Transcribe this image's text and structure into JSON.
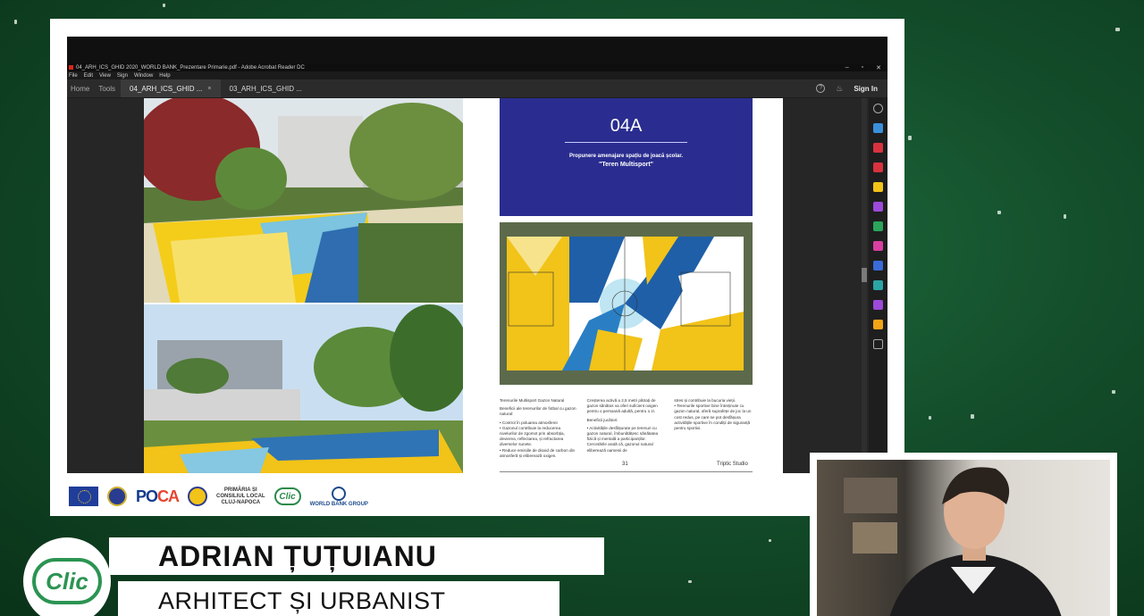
{
  "acrobat": {
    "window_title": "04_ARH_ICS_GHID 2020_WORLD BANK_Prezentare Primarie.pdf - Adobe Acrobat Reader DC",
    "window_controls": [
      "–",
      "▫",
      "✕"
    ],
    "menu": [
      "File",
      "Edit",
      "View",
      "Sign",
      "Window",
      "Help"
    ],
    "nav": [
      "Home",
      "Tools"
    ],
    "tabs": [
      {
        "label": "04_ARH_ICS_GHID ...",
        "close": "×"
      },
      {
        "label": "03_ARH_ICS_GHID ..."
      }
    ],
    "help_icon": "?",
    "sign_in": "Sign In"
  },
  "document": {
    "panel_code": "04A",
    "panel_subtitle": "Propunere amenajare spațiu de joacă școlar.",
    "panel_title": "\"Teren Multisport\"",
    "col1": [
      "Terenurile Multisport Gazon Natural",
      "Beneficii ale terenurilor de fotbal cu gazon natural:",
      "• Control în poluarea atmosferei\n• Gazonul contribuie la reducerea nivelurilor de zgomot prin absorbția, devierea, reflectarea, și refractarea diverselor sunete.\n• Reduce emisiile de dioxid de carbon din atmosferă și eliberează oxigen."
    ],
    "col2": [
      "Creșterea activă a 2,5 metri pătrați de gazon sănătos va oferi suficient oxigen pentru o persoană adultă, pentru o zi.",
      "Beneficii jucători:",
      "• Activitățile desfășurate pe terenuri cu gazon natural, îmbunătățesc sănătatea fizică și mentală a participanților. Cercetările arată că, gazonul natural eliberează oamenii de"
    ],
    "col3": [
      "stres și contribuie la bucuria vieții.\n• Terenurile sportive bine întreținute cu gazon natural, oferă suprafețe de joc la un cost redus, pe care se pot desfășura activitățile sportive în condiții de siguranță pentru sportivi."
    ],
    "page_number": "31",
    "studio": "Triptic Studio"
  },
  "logos": {
    "eu": "UNIUNEA EUROPEANĂ",
    "poca_main": "PO",
    "poca_accent": "CA",
    "poca_sub": "Programul Operațional Capacitate Administrativă",
    "primaria": "PRIMĂRIA ȘI\nCONSILIUL LOCAL\nCLUJ-NAPOCA",
    "clic_small": "Clic",
    "world_bank": "WORLD BANK GROUP"
  },
  "lower_third": {
    "logo": "Clic",
    "name": "ADRIAN ȚUȚUIANU",
    "role": "ARHITECT ȘI URBANIST"
  },
  "colors": {
    "background": "#134d2a",
    "panel_blue": "#2a2d8f",
    "court_yellow": "#f2c318",
    "court_blue": "#1f5fa8",
    "clic_green": "#2b9452"
  }
}
